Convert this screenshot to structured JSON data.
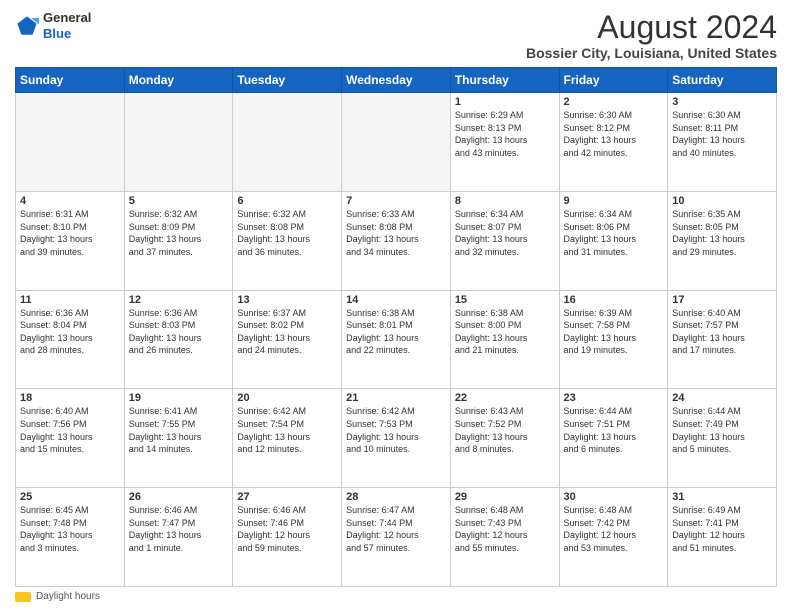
{
  "logo": {
    "line1": "General",
    "line2": "Blue"
  },
  "title": "August 2024",
  "subtitle": "Bossier City, Louisiana, United States",
  "days_of_week": [
    "Sunday",
    "Monday",
    "Tuesday",
    "Wednesday",
    "Thursday",
    "Friday",
    "Saturday"
  ],
  "footer_label": "Daylight hours",
  "weeks": [
    [
      {
        "day": "",
        "info": ""
      },
      {
        "day": "",
        "info": ""
      },
      {
        "day": "",
        "info": ""
      },
      {
        "day": "",
        "info": ""
      },
      {
        "day": "1",
        "info": "Sunrise: 6:29 AM\nSunset: 8:13 PM\nDaylight: 13 hours\nand 43 minutes."
      },
      {
        "day": "2",
        "info": "Sunrise: 6:30 AM\nSunset: 8:12 PM\nDaylight: 13 hours\nand 42 minutes."
      },
      {
        "day": "3",
        "info": "Sunrise: 6:30 AM\nSunset: 8:11 PM\nDaylight: 13 hours\nand 40 minutes."
      }
    ],
    [
      {
        "day": "4",
        "info": "Sunrise: 6:31 AM\nSunset: 8:10 PM\nDaylight: 13 hours\nand 39 minutes."
      },
      {
        "day": "5",
        "info": "Sunrise: 6:32 AM\nSunset: 8:09 PM\nDaylight: 13 hours\nand 37 minutes."
      },
      {
        "day": "6",
        "info": "Sunrise: 6:32 AM\nSunset: 8:08 PM\nDaylight: 13 hours\nand 36 minutes."
      },
      {
        "day": "7",
        "info": "Sunrise: 6:33 AM\nSunset: 8:08 PM\nDaylight: 13 hours\nand 34 minutes."
      },
      {
        "day": "8",
        "info": "Sunrise: 6:34 AM\nSunset: 8:07 PM\nDaylight: 13 hours\nand 32 minutes."
      },
      {
        "day": "9",
        "info": "Sunrise: 6:34 AM\nSunset: 8:06 PM\nDaylight: 13 hours\nand 31 minutes."
      },
      {
        "day": "10",
        "info": "Sunrise: 6:35 AM\nSunset: 8:05 PM\nDaylight: 13 hours\nand 29 minutes."
      }
    ],
    [
      {
        "day": "11",
        "info": "Sunrise: 6:36 AM\nSunset: 8:04 PM\nDaylight: 13 hours\nand 28 minutes."
      },
      {
        "day": "12",
        "info": "Sunrise: 6:36 AM\nSunset: 8:03 PM\nDaylight: 13 hours\nand 26 minutes."
      },
      {
        "day": "13",
        "info": "Sunrise: 6:37 AM\nSunset: 8:02 PM\nDaylight: 13 hours\nand 24 minutes."
      },
      {
        "day": "14",
        "info": "Sunrise: 6:38 AM\nSunset: 8:01 PM\nDaylight: 13 hours\nand 22 minutes."
      },
      {
        "day": "15",
        "info": "Sunrise: 6:38 AM\nSunset: 8:00 PM\nDaylight: 13 hours\nand 21 minutes."
      },
      {
        "day": "16",
        "info": "Sunrise: 6:39 AM\nSunset: 7:58 PM\nDaylight: 13 hours\nand 19 minutes."
      },
      {
        "day": "17",
        "info": "Sunrise: 6:40 AM\nSunset: 7:57 PM\nDaylight: 13 hours\nand 17 minutes."
      }
    ],
    [
      {
        "day": "18",
        "info": "Sunrise: 6:40 AM\nSunset: 7:56 PM\nDaylight: 13 hours\nand 15 minutes."
      },
      {
        "day": "19",
        "info": "Sunrise: 6:41 AM\nSunset: 7:55 PM\nDaylight: 13 hours\nand 14 minutes."
      },
      {
        "day": "20",
        "info": "Sunrise: 6:42 AM\nSunset: 7:54 PM\nDaylight: 13 hours\nand 12 minutes."
      },
      {
        "day": "21",
        "info": "Sunrise: 6:42 AM\nSunset: 7:53 PM\nDaylight: 13 hours\nand 10 minutes."
      },
      {
        "day": "22",
        "info": "Sunrise: 6:43 AM\nSunset: 7:52 PM\nDaylight: 13 hours\nand 8 minutes."
      },
      {
        "day": "23",
        "info": "Sunrise: 6:44 AM\nSunset: 7:51 PM\nDaylight: 13 hours\nand 6 minutes."
      },
      {
        "day": "24",
        "info": "Sunrise: 6:44 AM\nSunset: 7:49 PM\nDaylight: 13 hours\nand 5 minutes."
      }
    ],
    [
      {
        "day": "25",
        "info": "Sunrise: 6:45 AM\nSunset: 7:48 PM\nDaylight: 13 hours\nand 3 minutes."
      },
      {
        "day": "26",
        "info": "Sunrise: 6:46 AM\nSunset: 7:47 PM\nDaylight: 13 hours\nand 1 minute."
      },
      {
        "day": "27",
        "info": "Sunrise: 6:46 AM\nSunset: 7:46 PM\nDaylight: 12 hours\nand 59 minutes."
      },
      {
        "day": "28",
        "info": "Sunrise: 6:47 AM\nSunset: 7:44 PM\nDaylight: 12 hours\nand 57 minutes."
      },
      {
        "day": "29",
        "info": "Sunrise: 6:48 AM\nSunset: 7:43 PM\nDaylight: 12 hours\nand 55 minutes."
      },
      {
        "day": "30",
        "info": "Sunrise: 6:48 AM\nSunset: 7:42 PM\nDaylight: 12 hours\nand 53 minutes."
      },
      {
        "day": "31",
        "info": "Sunrise: 6:49 AM\nSunset: 7:41 PM\nDaylight: 12 hours\nand 51 minutes."
      }
    ]
  ]
}
